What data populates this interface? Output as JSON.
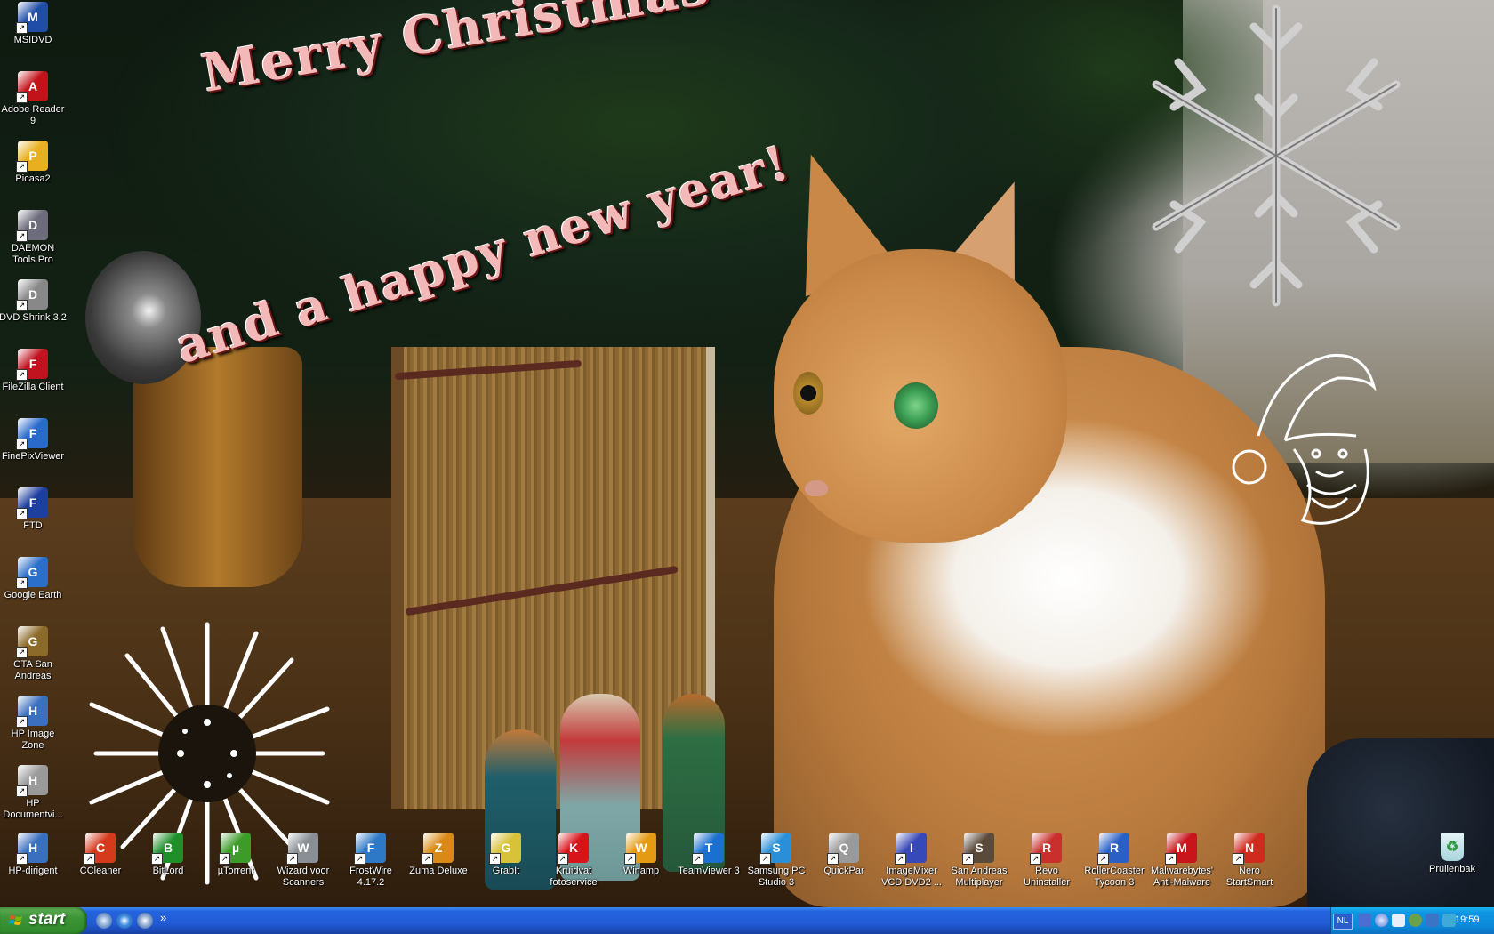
{
  "wallpaper": {
    "greeting_line1": "Merry Christmas",
    "greeting_line2": "and a happy new year!"
  },
  "desktop_icons_left": [
    {
      "label": "MSIDVD",
      "icon": "msidvd-icon",
      "color": "#1f4da8"
    },
    {
      "label": "Adobe Reader 9",
      "icon": "adobe-reader-icon",
      "color": "#c2131b"
    },
    {
      "label": "Picasa2",
      "icon": "picasa-icon",
      "color": "#e8b020"
    },
    {
      "label": "DAEMON Tools Pro",
      "icon": "daemon-tools-icon",
      "color": "#6c6c7c"
    },
    {
      "label": "DVD Shrink 3.2",
      "icon": "dvd-shrink-icon",
      "color": "#888888"
    },
    {
      "label": "FileZilla Client",
      "icon": "filezilla-icon",
      "color": "#c1121f"
    },
    {
      "label": "FinePixViewer",
      "icon": "finepix-icon",
      "color": "#2a6acb"
    },
    {
      "label": "FTD",
      "icon": "ftd-icon",
      "color": "#1d3f9f"
    },
    {
      "label": "Google Earth",
      "icon": "google-earth-icon",
      "color": "#2a6fc9"
    },
    {
      "label": "GTA San Andreas",
      "icon": "gta-san-andreas-icon",
      "color": "#8c6a2a"
    },
    {
      "label": "HP  Image Zone",
      "icon": "hp-image-zone-icon",
      "color": "#3b6fbf"
    },
    {
      "label": "HP Documentvi...",
      "icon": "hp-document-viewer-icon",
      "color": "#9a9a9a"
    }
  ],
  "desktop_icons_bottom": [
    {
      "label": "HP-dirigent",
      "icon": "hp-dirigent-icon",
      "color": "#3a6fbf"
    },
    {
      "label": "CCleaner",
      "icon": "ccleaner-icon",
      "color": "#d53a1c"
    },
    {
      "label": "BitLord",
      "icon": "bitlord-icon",
      "color": "#1f8f2a"
    },
    {
      "label": "µTorrent",
      "icon": "utorrent-icon",
      "color": "#3d9b2a"
    },
    {
      "label": "Wizard voor Scanners",
      "icon": "scanner-wizard-icon",
      "color": "#8a8f96"
    },
    {
      "label": "FrostWire 4.17.2",
      "icon": "frostwire-icon",
      "color": "#2d79c7"
    },
    {
      "label": "Zuma Deluxe",
      "icon": "zuma-deluxe-icon",
      "color": "#d98a16"
    },
    {
      "label": "GrabIt",
      "icon": "grabit-icon",
      "color": "#d8c23a"
    },
    {
      "label": "Kruidvat fotoservice",
      "icon": "kruidvat-icon",
      "color": "#d8141b"
    },
    {
      "label": "Winamp",
      "icon": "winamp-icon",
      "color": "#e59a14"
    },
    {
      "label": "TeamViewer 3",
      "icon": "teamviewer-icon",
      "color": "#1b6fd0"
    },
    {
      "label": "Samsung PC Studio 3",
      "icon": "samsung-pc-studio-icon",
      "color": "#2a8fd6"
    },
    {
      "label": "QuickPar",
      "icon": "quickpar-icon",
      "color": "#9a9a9a"
    },
    {
      "label": "ImageMixer VCD DVD2 ...",
      "icon": "imagemixer-icon",
      "color": "#3748b8"
    },
    {
      "label": "San Andreas Multiplayer",
      "icon": "san-andreas-multiplayer-icon",
      "color": "#5a4a3a"
    },
    {
      "label": "Revo Uninstaller",
      "icon": "revo-uninstaller-icon",
      "color": "#c9302c"
    },
    {
      "label": "RollerCoaster Tycoon 3",
      "icon": "rollercoaster-tycoon-icon",
      "color": "#2a5fc6"
    },
    {
      "label": "Malwarebytes' Anti-Malware",
      "icon": "malwarebytes-icon",
      "color": "#c8141b"
    },
    {
      "label": "Nero StartSmart",
      "icon": "nero-icon",
      "color": "#cf2a1e"
    }
  ],
  "recycle_bin": {
    "label": "Prullenbak",
    "icon": "recycle-bin-icon",
    "color": "#3aa64a"
  },
  "taskbar": {
    "start_label": "start",
    "quicklaunch_expand": "»",
    "language": "NL",
    "clock": "19:59"
  },
  "colors": {
    "taskbar_blue": "#245edb",
    "start_green": "#3c9436",
    "tray_blue": "#0f96e3"
  }
}
